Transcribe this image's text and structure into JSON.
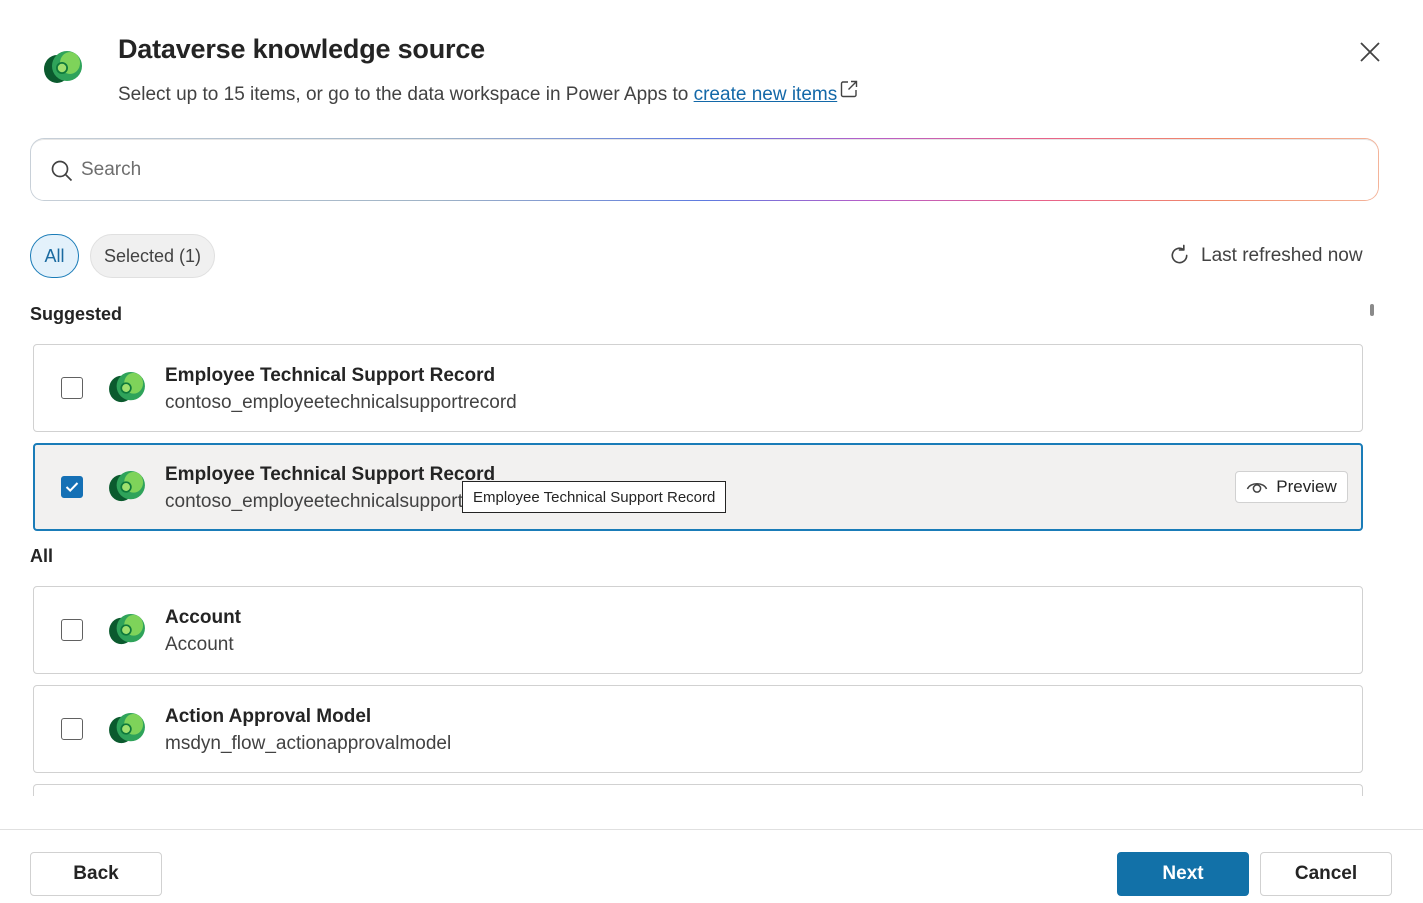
{
  "dialog": {
    "title": "Dataverse knowledge source",
    "subtitle_text": "Select up to 15 items, or go to the data workspace in Power Apps to ",
    "subtitle_link": "create new items"
  },
  "search": {
    "placeholder": "Search",
    "value": ""
  },
  "filters": {
    "all_label": "All",
    "selected_label": "Selected (1)",
    "active": "All"
  },
  "refresh": {
    "label": "Last refreshed now"
  },
  "sections": {
    "suggested": "Suggested",
    "all": "All"
  },
  "suggested_items": [
    {
      "title": "Employee Technical Support Record",
      "name": "contoso_employeetechnicalsupportrecord",
      "checked": false
    },
    {
      "title": "Employee Technical Support Record",
      "name": "contoso_employeetechnicalsupportrecord",
      "checked": true
    }
  ],
  "all_items": [
    {
      "title": "Account",
      "name": "Account",
      "checked": false
    },
    {
      "title": "Action Approval Model",
      "name": "msdyn_flow_actionapprovalmodel",
      "checked": false
    }
  ],
  "preview_label": "Preview",
  "tooltip": "Employee Technical Support Record",
  "footer": {
    "back": "Back",
    "next": "Next",
    "cancel": "Cancel"
  },
  "colors": {
    "accent": "#1271a8",
    "selected_bg": "#f2f1f0",
    "logo_dark": "#0b5a2e",
    "logo_mid": "#1e8f4e",
    "logo_light": "#7ed35a"
  },
  "icons": {
    "header": "dataverse-logo-icon",
    "close": "close-icon",
    "search": "search-icon",
    "refresh": "refresh-icon",
    "external": "external-link-icon",
    "preview": "eye-icon",
    "check": "checkmark-icon"
  }
}
